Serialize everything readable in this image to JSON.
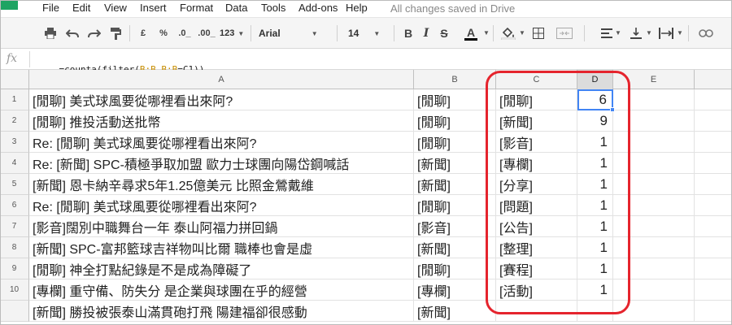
{
  "menubar": {
    "items": [
      "File",
      "Edit",
      "View",
      "Insert",
      "Format",
      "Data",
      "Tools",
      "Add-ons",
      "Help"
    ],
    "save_status": "All changes saved in Drive"
  },
  "toolbar": {
    "currency_label": "£",
    "percent_label": "%",
    "decrease_decimal_label": ".0_",
    "increase_decimal_label": ".00_",
    "number_format_label": "123",
    "font_family": "Arial",
    "font_size": "14",
    "bold_label": "B",
    "italic_label": "I",
    "strike_label": "S",
    "text_color_label": "A",
    "text_color": "#000000",
    "icons": [
      "print-icon",
      "undo-icon",
      "redo-icon",
      "paint-format-icon",
      "fill-color-icon",
      "borders-icon",
      "merge-icon",
      "align-icon",
      "valign-icon",
      "text-wrap-icon",
      "link-icon"
    ]
  },
  "formula_bar": {
    "fx_label": "fx",
    "formula_parts": [
      {
        "text": "=counta(filter(",
        "ref": false
      },
      {
        "text": "B:B",
        "ref": true
      },
      {
        "text": ",",
        "ref": false
      },
      {
        "text": "B:B",
        "ref": true
      },
      {
        "text": "=C1))",
        "ref": false
      }
    ]
  },
  "grid": {
    "columns": [
      "A",
      "B",
      "C",
      "D",
      "E"
    ],
    "active_column": "D",
    "selected_cell": "D1",
    "rows": [
      {
        "n": "1",
        "a": "[閒聊] 美式球風要從哪裡看出來阿?",
        "b": "[閒聊]",
        "c": "[閒聊]",
        "d": "6"
      },
      {
        "n": "2",
        "a": "[閒聊] 推投活動送批幣",
        "b": "[閒聊]",
        "c": "[新聞]",
        "d": "9"
      },
      {
        "n": "3",
        "a": "Re: [閒聊] 美式球風要從哪裡看出來阿?",
        "b": "[閒聊]",
        "c": "[影音]",
        "d": "1"
      },
      {
        "n": "4",
        "a": "Re: [新聞] SPC-積極爭取加盟 歐力士球團向陽岱鋼喊話",
        "b": "[新聞]",
        "c": "[專欄]",
        "d": "1"
      },
      {
        "n": "5",
        "a": "[新聞] 恩卡納辛尋求5年1.25億美元 比照金鶯戴維",
        "b": "[新聞]",
        "c": "[分享]",
        "d": "1"
      },
      {
        "n": "6",
        "a": "Re: [閒聊] 美式球風要從哪裡看出來阿?",
        "b": "[閒聊]",
        "c": "[問題]",
        "d": "1"
      },
      {
        "n": "7",
        "a": "[影音]闊別中職舞台一年 泰山阿福力拼回鍋",
        "b": "[影音]",
        "c": "[公告]",
        "d": "1"
      },
      {
        "n": "8",
        "a": "[新聞] SPC-富邦籃球吉祥物叫比爾 職棒也會是虛",
        "b": "[新聞]",
        "c": "[整理]",
        "d": "1"
      },
      {
        "n": "9",
        "a": "[閒聊] 神全打點紀錄是不是成為障礙了",
        "b": "[閒聊]",
        "c": "[賽程]",
        "d": "1"
      },
      {
        "n": "10",
        "a": "[專欄] 重守備、防失分 是企業與球團在乎的經營",
        "b": "[專欄]",
        "c": "[活動]",
        "d": "1"
      },
      {
        "n": "",
        "a": "[新聞] 勝投被張泰山滿貫砲打飛 陽建福卻很感動",
        "b": "[新聞]",
        "c": "",
        "d": ""
      }
    ]
  },
  "colors": {
    "annotation": "#e5242d",
    "selection": "#4285f4",
    "formula_ref": "#c78d00",
    "sheets_green": "#1fa463"
  }
}
